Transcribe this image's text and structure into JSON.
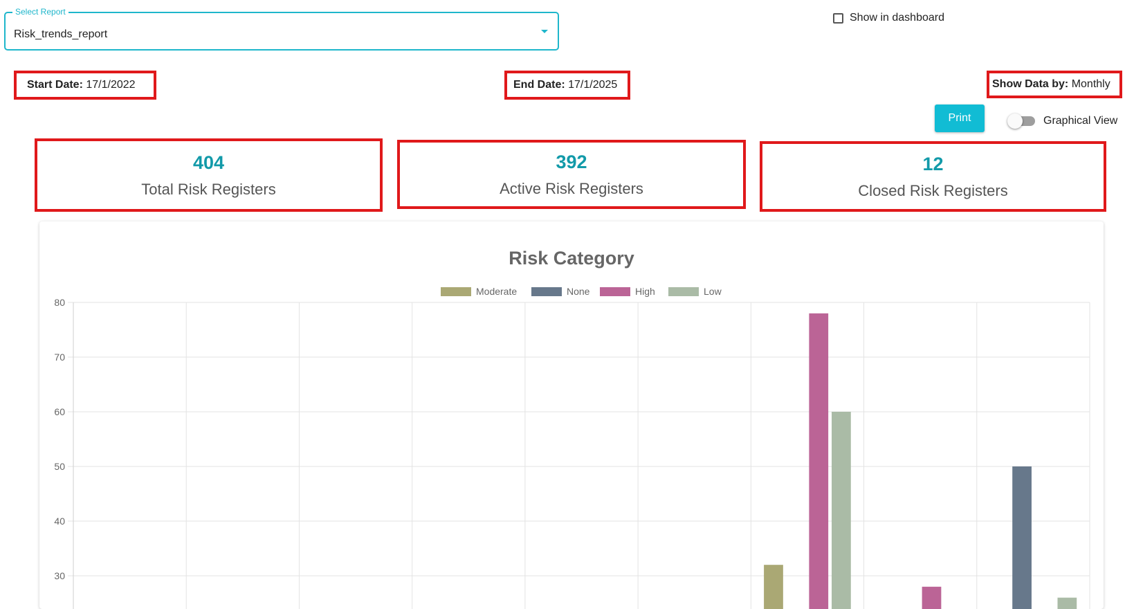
{
  "select_report": {
    "label": "Select Report",
    "value": "Risk_trends_report"
  },
  "dashboard_checkbox": {
    "label": "Show in dashboard",
    "checked": false
  },
  "filters": {
    "start_label": "Start Date:",
    "start_value": "17/1/2022",
    "end_label": "End Date:",
    "end_value": "17/1/2025",
    "show_label": "Show Data by:",
    "show_value": "Monthly"
  },
  "print_label": "Print",
  "graphical_view": {
    "label": "Graphical View",
    "on": false
  },
  "stats": [
    {
      "value": "404",
      "label": "Total Risk Registers"
    },
    {
      "value": "392",
      "label": "Active Risk Registers"
    },
    {
      "value": "12",
      "label": "Closed Risk Registers"
    }
  ],
  "colors": {
    "accent": "#1eb6cb",
    "stat": "#129aa9",
    "highlight": "#e0191b"
  },
  "chart_data": {
    "type": "bar",
    "title": "Risk Category",
    "ylim": [
      20,
      80
    ],
    "yticks": [
      80,
      70,
      60,
      50,
      40,
      30
    ],
    "grid": true,
    "legend_position": "top",
    "category_count": 9,
    "series": [
      {
        "name": "Moderate",
        "color": "#aaa874",
        "values": [
          null,
          null,
          null,
          null,
          null,
          null,
          32,
          null,
          null
        ]
      },
      {
        "name": "None",
        "color": "#67788b",
        "values": [
          null,
          null,
          null,
          null,
          null,
          null,
          null,
          null,
          50
        ]
      },
      {
        "name": "High",
        "color": "#bb6496",
        "values": [
          null,
          null,
          null,
          null,
          null,
          null,
          78,
          28,
          null
        ]
      },
      {
        "name": "Low",
        "color": "#aabba6",
        "values": [
          null,
          null,
          null,
          null,
          null,
          null,
          60,
          null,
          26
        ]
      }
    ]
  }
}
